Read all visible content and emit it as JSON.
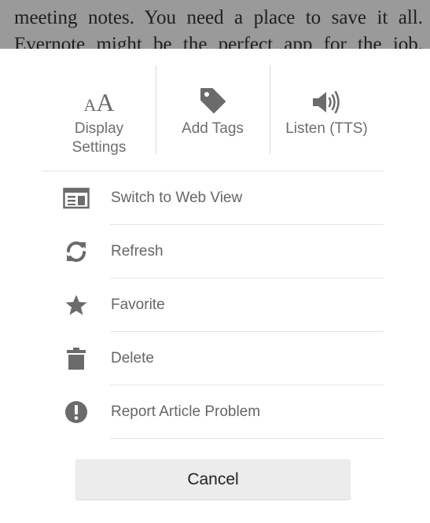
{
  "article": {
    "line1": "meeting notes. You need a place to save it all.",
    "line2": "Evernote might be the perfect app for the job."
  },
  "top_actions": {
    "display_settings": {
      "glyph": "AA",
      "label_line1": "Display",
      "label_line2": "Settings",
      "icon": "font-size-icon"
    },
    "add_tags": {
      "label": "Add Tags",
      "icon": "tag-icon"
    },
    "listen": {
      "label": "Listen (TTS)",
      "icon": "speaker-icon"
    }
  },
  "menu": {
    "items": [
      {
        "label": "Switch to Web View",
        "icon": "web-view-icon"
      },
      {
        "label": "Refresh",
        "icon": "refresh-icon"
      },
      {
        "label": "Favorite",
        "icon": "star-icon"
      },
      {
        "label": "Delete",
        "icon": "trash-icon"
      },
      {
        "label": "Report Article Problem",
        "icon": "alert-icon"
      }
    ]
  },
  "cancel_label": "Cancel",
  "colors": {
    "icon": "#6b6b6b",
    "label": "#666666",
    "dim_overlay": "#9a9a9a"
  }
}
